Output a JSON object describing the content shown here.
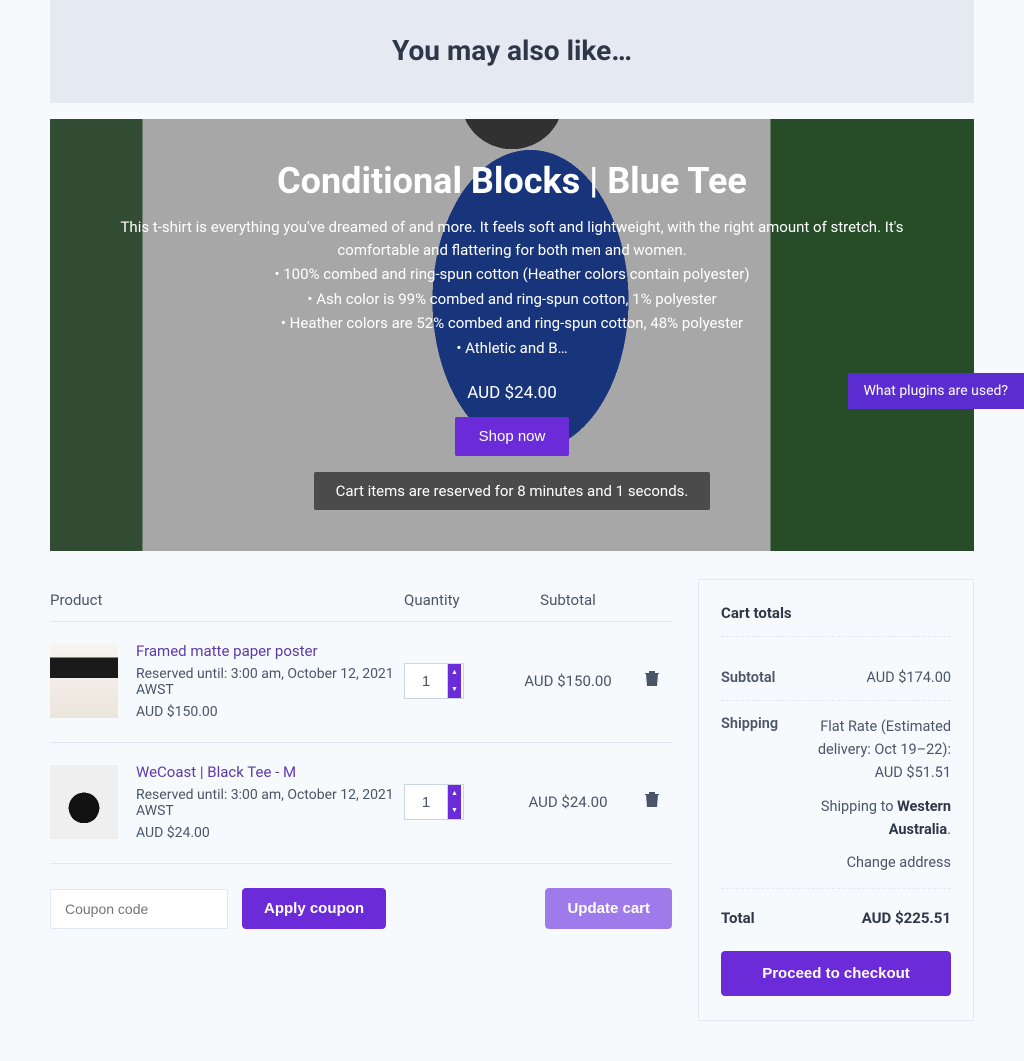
{
  "upsell_heading": "You may also like…",
  "hero": {
    "title": "Conditional Blocks | Blue Tee",
    "desc": "This t-shirt is everything you've dreamed of and more. It feels soft and lightweight, with the right amount of stretch. It's comfortable and flattering for both men and women.",
    "bullet_1": "• 100% combed and ring-spun cotton (Heather colors contain polyester)",
    "bullet_2": "• Ash color is 99% combed and ring-spun cotton, 1% polyester",
    "bullet_3": "• Heather colors are 52% combed and ring-spun cotton, 48% polyester",
    "bullet_4": "• Athletic and B…",
    "price": "AUD $24.00",
    "cta": "Shop now",
    "reservation": "Cart items are reserved for 8 minutes and 1 seconds."
  },
  "plugin_banner": "What plugins are used?",
  "cart": {
    "columns": {
      "product": "Product",
      "quantity": "Quantity",
      "subtotal": "Subtotal"
    },
    "items": [
      {
        "name": "Framed matte paper poster",
        "reserved": "Reserved until: 3:00 am, October 12, 2021 AWST",
        "price": "AUD $150.00",
        "qty": "1",
        "subtotal": "AUD $150.00"
      },
      {
        "name": "WeCoast | Black Tee - M",
        "reserved": "Reserved until: 3:00 am, October 12, 2021 AWST",
        "price": "AUD $24.00",
        "qty": "1",
        "subtotal": "AUD $24.00"
      }
    ],
    "coupon_placeholder": "Coupon code",
    "apply_coupon": "Apply coupon",
    "update_cart": "Update cart"
  },
  "totals": {
    "heading": "Cart totals",
    "subtotal_label": "Subtotal",
    "subtotal_value": "AUD $174.00",
    "shipping_label": "Shipping",
    "shipping_rate": "Flat Rate (Estimated delivery: Oct 19–22): AUD $51.51",
    "shipping_to_prefix": "Shipping to ",
    "shipping_to_region": "Western Australia",
    "shipping_to_suffix": ".",
    "change_address": "Change address",
    "total_label": "Total",
    "total_value": "AUD $225.51",
    "checkout": "Proceed to checkout"
  }
}
